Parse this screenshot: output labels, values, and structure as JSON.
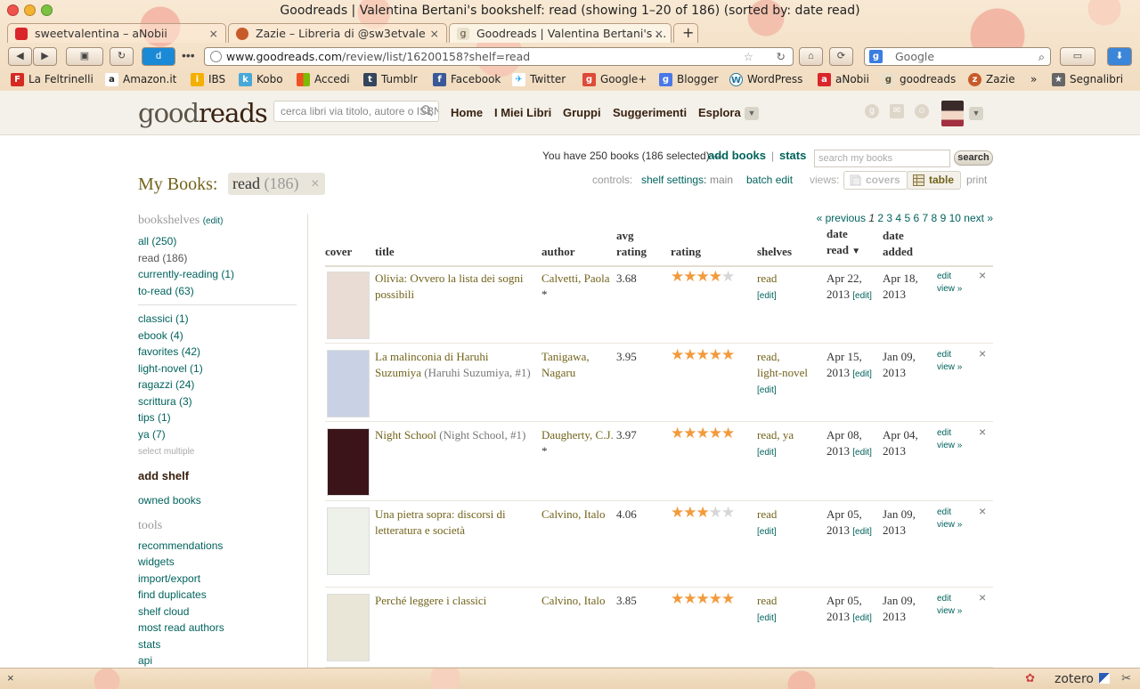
{
  "window": {
    "title": "Goodreads | Valentina Bertani's bookshelf: read (showing 1–20 of 186) (sorted by: date read)"
  },
  "tabs": [
    {
      "label": "sweetvalentina – aNobii",
      "close": "×"
    },
    {
      "label": "Zazie – Libreria di @sw3etvale",
      "close": "×"
    },
    {
      "label": "Goodreads | Valentina Bertani's ...",
      "close": "×"
    }
  ],
  "new_tab": "+",
  "address": {
    "host": "www.goodreads.com",
    "path": "/review/list/16200158?shelf=read"
  },
  "web_search": {
    "placeholder": "Google"
  },
  "bookmarks": [
    "La Feltrinelli",
    "Amazon.it",
    "IBS",
    "Kobo",
    "Accedi",
    "Tumblr",
    "Facebook",
    "Twitter",
    "Google+",
    "Blogger",
    "WordPress",
    "aNobii",
    "goodreads",
    "Zazie"
  ],
  "bookmarks_overflow": "»",
  "bookmarks_menu": "Segnalibri",
  "site": {
    "logo_a": "good",
    "logo_b": "reads",
    "search_placeholder": "cerca libri via titolo, autore o ISBN",
    "nav": [
      "Home",
      "I Miei Libri",
      "Gruppi",
      "Suggerimenti",
      "Esplora"
    ]
  },
  "summary": {
    "text": "You have 250 books (186 selected) —",
    "add_books": "add books",
    "sep": "|",
    "stats": "stats",
    "search_placeholder": "search my books",
    "search_button": "search"
  },
  "heading": {
    "title": "My Books:",
    "shelf": "read",
    "count": "(186)",
    "remove": "×"
  },
  "controls": {
    "label": "controls:",
    "shelf_settings": "shelf settings:",
    "main": "main",
    "batch_edit": "batch edit",
    "views_label": "views:",
    "covers": "covers",
    "table": "table",
    "print": "print"
  },
  "sidebar": {
    "bookshelves_title": "bookshelves",
    "edit": "(edit)",
    "main_shelves": [
      "all (250)",
      "read (186)",
      "currently-reading (1)",
      "to-read (63)"
    ],
    "custom_shelves": [
      "classici (1)",
      "ebook (4)",
      "favorites (42)",
      "light-novel (1)",
      "ragazzi (24)",
      "scrittura (3)",
      "tips (1)",
      "ya (7)"
    ],
    "select_multiple": "select multiple",
    "add_shelf": "add shelf",
    "owned_books": "owned books",
    "tools_title": "tools",
    "tools": [
      "recommendations",
      "widgets",
      "import/export",
      "find duplicates",
      "shelf cloud",
      "most read authors",
      "stats",
      "api"
    ]
  },
  "pager": {
    "previous": "« previous",
    "current": "1",
    "pages": [
      "2",
      "3",
      "4",
      "5",
      "6",
      "7",
      "8",
      "9",
      "10"
    ],
    "next": "next »"
  },
  "columns": {
    "cover": "cover",
    "title": "title",
    "author": "author",
    "avg1": "avg",
    "avg2": "rating",
    "rating": "rating",
    "shelves": "shelves",
    "read1": "date",
    "read2": "read",
    "added1": "date",
    "added2": "added"
  },
  "books": [
    {
      "title": "Olivia: Ovvero la lista dei sogni possibili",
      "series": "",
      "author": "Calvetti, Paola",
      "author_star": "*",
      "avg": "3.68",
      "stars": 4,
      "shelves": "read",
      "shelves2": "",
      "read_date": "Apr 22,",
      "read_year": "2013",
      "added_date": "Apr 18,",
      "added_year": "2013",
      "cover_color": "#e8dcd4"
    },
    {
      "title": "La malinconia di Haruhi Suzumiya",
      "series": "(Haruhi Suzumiya, #1)",
      "author": "Tanigawa, Nagaru",
      "author_star": "",
      "avg": "3.95",
      "stars": 5,
      "shelves": "read,",
      "shelves2": "light-novel",
      "read_date": "Apr 15,",
      "read_year": "2013",
      "added_date": "Jan 09,",
      "added_year": "2013",
      "cover_color": "#c8d2e4"
    },
    {
      "title": "Night School",
      "series": "(Night School, #1)",
      "author": "Daugherty, C.J.",
      "author_star": "*",
      "avg": "3.97",
      "stars": 5,
      "shelves": "read, ya",
      "shelves2": "",
      "read_date": "Apr 08,",
      "read_year": "2013",
      "added_date": "Apr 04,",
      "added_year": "2013",
      "cover_color": "#3a1418"
    },
    {
      "title": "Una pietra sopra: discorsi di letteratura e società",
      "series": "",
      "author": "Calvino, Italo",
      "author_star": "",
      "avg": "4.06",
      "stars": 3,
      "shelves": "read",
      "shelves2": "",
      "read_date": "Apr 05,",
      "read_year": "2013",
      "added_date": "Jan 09,",
      "added_year": "2013",
      "cover_color": "#eef0ea"
    },
    {
      "title": "Perché leggere i classici",
      "series": "",
      "author": "Calvino, Italo",
      "author_star": "",
      "avg": "3.85",
      "stars": 5,
      "shelves": "read",
      "shelves2": "",
      "read_date": "Apr 05,",
      "read_year": "2013",
      "added_date": "Jan 09,",
      "added_year": "2013",
      "cover_color": "#e9e6d8"
    }
  ],
  "row_labels": {
    "edit": "[edit]",
    "edit_link": "edit",
    "view": "view »",
    "remove": "×"
  },
  "status": {
    "zotero": "zotero"
  }
}
